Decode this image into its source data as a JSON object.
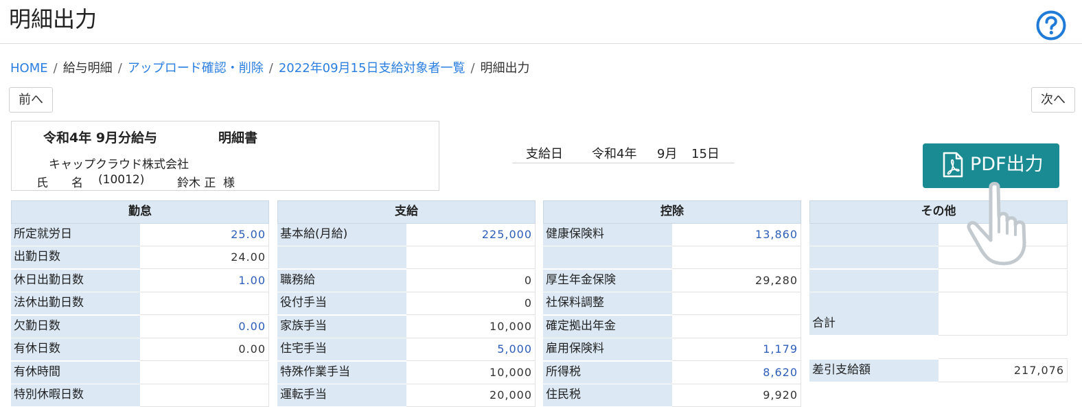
{
  "header": {
    "title": "明細出力",
    "help_icon": "question-circle-icon"
  },
  "breadcrumb": {
    "items": [
      {
        "label": "HOME",
        "link": true
      },
      {
        "label": "給与明細",
        "link": false
      },
      {
        "label": "アップロード確認・削除",
        "link": true
      },
      {
        "label": "2022年09月15日支給対象者一覧",
        "link": true
      },
      {
        "label": "明細出力",
        "link": false
      }
    ],
    "separator": "/"
  },
  "nav": {
    "prev_label": "前へ",
    "next_label": "次へ"
  },
  "payslip": {
    "title": "令和4年 9月分給与",
    "title_suffix": "明細書",
    "company": "キャップクラウド株式会社",
    "employee_label": "氏　　名",
    "employee_code": "(10012)",
    "employee_name": "鈴木 正",
    "honorific": "様"
  },
  "paydate": {
    "label": "支給日",
    "era_year": "令和4年",
    "month": "9月",
    "day": "15日"
  },
  "pdf_button": {
    "label": "PDF出力",
    "icon": "pdf-file-icon",
    "color": "#1a8a93"
  },
  "sections": {
    "attendance": {
      "title": "勤怠",
      "rows": [
        {
          "label": "所定就労日",
          "value": "25.00"
        },
        {
          "label": "出勤日数",
          "value": "24.00"
        },
        {
          "label": "休日出勤日数",
          "value": "1.00"
        },
        {
          "label": "法休出勤日数",
          "value": ""
        },
        {
          "label": "欠勤日数",
          "value": "0.00"
        },
        {
          "label": "有休日数",
          "value": "0.00"
        },
        {
          "label": "有休時間",
          "value": ""
        },
        {
          "label": "特別休暇日数",
          "value": ""
        }
      ]
    },
    "payments": {
      "title": "支給",
      "rows": [
        {
          "label": "基本給(月給)",
          "value": "225,000"
        },
        {
          "label": "",
          "value": ""
        },
        {
          "label": "職務給",
          "value": "0"
        },
        {
          "label": "役付手当",
          "value": "0"
        },
        {
          "label": "家族手当",
          "value": "10,000"
        },
        {
          "label": "住宅手当",
          "value": "5,000"
        },
        {
          "label": "特殊作業手当",
          "value": "10,000"
        },
        {
          "label": "運転手当",
          "value": "20,000"
        }
      ]
    },
    "deductions": {
      "title": "控除",
      "rows": [
        {
          "label": "健康保険料",
          "value": "13,860"
        },
        {
          "label": "",
          "value": ""
        },
        {
          "label": "厚生年金保険",
          "value": "29,280"
        },
        {
          "label": "社保料調整",
          "value": ""
        },
        {
          "label": "確定拠出年金",
          "value": ""
        },
        {
          "label": "雇用保険料",
          "value": "1,179"
        },
        {
          "label": "所得税",
          "value": "8,620"
        },
        {
          "label": "住民税",
          "value": "9,920"
        }
      ]
    },
    "other": {
      "title": "その他",
      "rows": [
        {
          "label": "",
          "value": ""
        },
        {
          "label": "",
          "value": ""
        },
        {
          "label": "",
          "value": ""
        },
        {
          "label": "",
          "value": ""
        },
        {
          "label": "合計",
          "value": ""
        },
        {
          "label": "",
          "value": ""
        },
        {
          "label": "差引支給額",
          "value": "217,076"
        }
      ]
    }
  },
  "overlay": {
    "cursor_icon": "pointing-hand-icon"
  }
}
